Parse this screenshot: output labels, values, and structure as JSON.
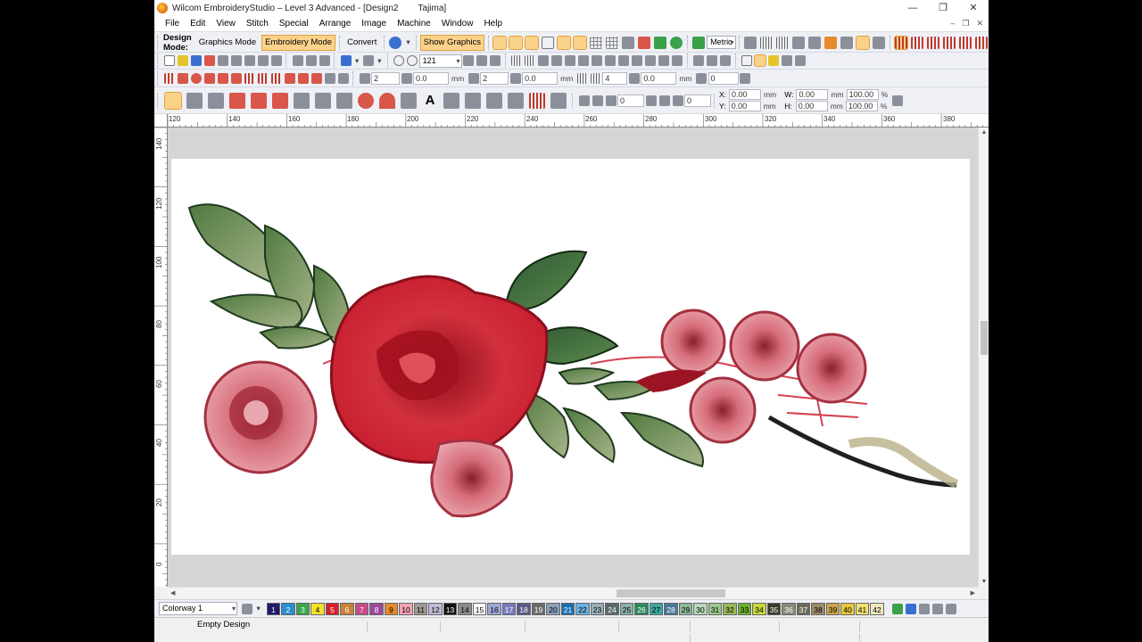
{
  "window": {
    "title": "Wilcom EmbroideryStudio – Level 3 Advanced - [Design2        Tajima]",
    "controls": [
      "—",
      "❐",
      "✕"
    ]
  },
  "menu": {
    "items": [
      "File",
      "Edit",
      "View",
      "Stitch",
      "Special",
      "Arrange",
      "Image",
      "Machine",
      "Window",
      "Help"
    ],
    "doc_controls": [
      "–",
      "❐",
      "✕"
    ]
  },
  "toolbar": {
    "design_mode_label": "Design Mode:",
    "graphics_mode": "Graphics Mode",
    "embroidery_mode": "Embroidery Mode",
    "convert": "Convert",
    "show_graphics": "Show Graphics",
    "units": "Metric",
    "zoom": "121",
    "spin_values": [
      "2",
      "0.0",
      "2",
      "0.0",
      "4",
      "0.0",
      "0.0",
      "0",
      "0"
    ],
    "mm_labels": [
      "mm",
      "mm",
      "mm"
    ],
    "pos_x_label": "X:",
    "pos_y_label": "Y:",
    "pos_x": "0.00",
    "pos_y": "0.00",
    "width_label": "W:",
    "height_label": "H:",
    "width": "0.00",
    "height": "0.00",
    "scale_w": "100.00",
    "scale_h": "100.00",
    "unit_mm": "mm",
    "unit_pct": "%"
  },
  "ruler": {
    "h_labels": [
      "120",
      "140",
      "160",
      "180",
      "200",
      "220",
      "240",
      "260",
      "280",
      "300",
      "320",
      "340",
      "360",
      "380"
    ],
    "v_labels": [
      "140",
      "120",
      "100",
      "80",
      "60",
      "40",
      "20",
      "0"
    ]
  },
  "colorbar": {
    "colorway": "Colorway 1",
    "swatches": [
      {
        "n": "1",
        "c": "#1f1a6b",
        "t": "#fff"
      },
      {
        "n": "2",
        "c": "#2a8fd0",
        "t": "#fff"
      },
      {
        "n": "3",
        "c": "#3aa54a",
        "t": "#fff"
      },
      {
        "n": "4",
        "c": "#f2e12b",
        "t": "#000"
      },
      {
        "n": "5",
        "c": "#d9202a",
        "t": "#fff"
      },
      {
        "n": "6",
        "c": "#c8823c",
        "t": "#fff"
      },
      {
        "n": "7",
        "c": "#c84a8a",
        "t": "#fff"
      },
      {
        "n": "8",
        "c": "#9b4a9c",
        "t": "#fff"
      },
      {
        "n": "9",
        "c": "#e88a2c",
        "t": "#000"
      },
      {
        "n": "10",
        "c": "#f3a2b0",
        "t": "#000"
      },
      {
        "n": "11",
        "c": "#a09a94",
        "t": "#000"
      },
      {
        "n": "12",
        "c": "#c4b8d8",
        "t": "#000"
      },
      {
        "n": "13",
        "c": "#111111",
        "t": "#fff"
      },
      {
        "n": "14",
        "c": "#8a8a8a",
        "t": "#000"
      },
      {
        "n": "15",
        "c": "#ffffff",
        "t": "#000"
      },
      {
        "n": "16",
        "c": "#9da7d8",
        "t": "#000"
      },
      {
        "n": "17",
        "c": "#7a78c0",
        "t": "#fff"
      },
      {
        "n": "18",
        "c": "#5a5a8a",
        "t": "#fff"
      },
      {
        "n": "19",
        "c": "#6a6a6a",
        "t": "#fff"
      },
      {
        "n": "20",
        "c": "#8aa0b8",
        "t": "#000"
      },
      {
        "n": "21",
        "c": "#1a6fb0",
        "t": "#fff"
      },
      {
        "n": "22",
        "c": "#6ab0e0",
        "t": "#000"
      },
      {
        "n": "23",
        "c": "#9ab0b8",
        "t": "#000"
      },
      {
        "n": "24",
        "c": "#5a6a6a",
        "t": "#fff"
      },
      {
        "n": "25",
        "c": "#8ab0a8",
        "t": "#000"
      },
      {
        "n": "26",
        "c": "#2a8a5a",
        "t": "#fff"
      },
      {
        "n": "27",
        "c": "#3aa8a0",
        "t": "#000"
      },
      {
        "n": "28",
        "c": "#4a7a9a",
        "t": "#fff"
      },
      {
        "n": "29",
        "c": "#8ab898",
        "t": "#000"
      },
      {
        "n": "30",
        "c": "#b8d8b8",
        "t": "#000"
      },
      {
        "n": "31",
        "c": "#9ac88a",
        "t": "#000"
      },
      {
        "n": "32",
        "c": "#9ab858",
        "t": "#000"
      },
      {
        "n": "33",
        "c": "#6ab02a",
        "t": "#000"
      },
      {
        "n": "34",
        "c": "#c8d83a",
        "t": "#000"
      },
      {
        "n": "35",
        "c": "#3a3a2a",
        "t": "#fff"
      },
      {
        "n": "36",
        "c": "#8a8a7a",
        "t": "#fff"
      },
      {
        "n": "37",
        "c": "#6a6a5a",
        "t": "#fff"
      },
      {
        "n": "38",
        "c": "#9a8a6a",
        "t": "#000"
      },
      {
        "n": "39",
        "c": "#c8a84a",
        "t": "#000"
      },
      {
        "n": "40",
        "c": "#e8c83a",
        "t": "#000"
      },
      {
        "n": "41",
        "c": "#f0e070",
        "t": "#000"
      },
      {
        "n": "42",
        "c": "#f0e8c0",
        "t": "#000"
      }
    ]
  },
  "status": {
    "message": "Empty Design"
  },
  "colors": {
    "accent": "#fbd28a",
    "canvas": "#ffffff",
    "workspace": "#d5d5d5"
  }
}
